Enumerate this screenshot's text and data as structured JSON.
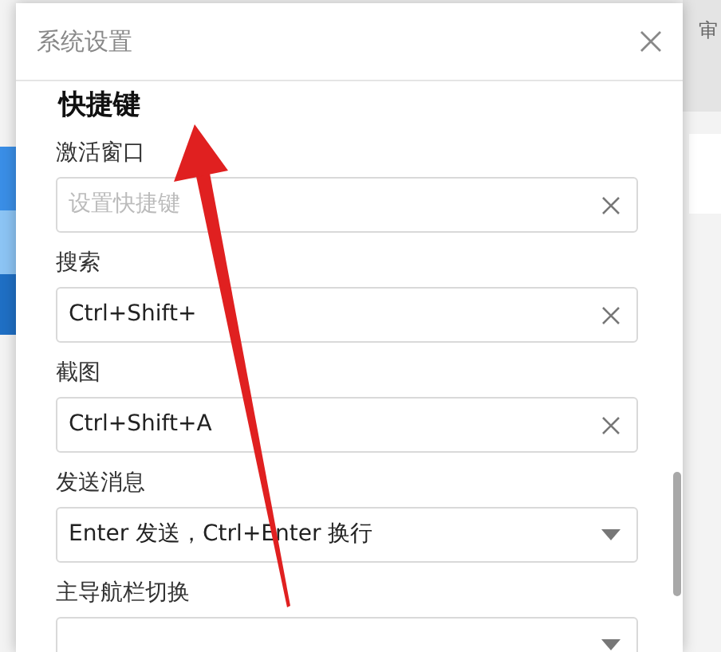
{
  "background": {
    "toolbar_text": "审"
  },
  "dialog": {
    "title": "系统设置",
    "section_title": "快捷键",
    "fields": [
      {
        "kind": "shortcut",
        "label": "激活窗口",
        "placeholder": "设置快捷键"
      },
      {
        "kind": "shortcut",
        "label": "搜索",
        "value": "Ctrl+Shift+"
      },
      {
        "kind": "shortcut",
        "label": "截图",
        "value": "Ctrl+Shift+A"
      },
      {
        "kind": "select",
        "label": "发送消息",
        "value": "Enter 发送，Ctrl+Enter 换行"
      },
      {
        "kind": "select",
        "label": "主导航栏切换"
      }
    ]
  }
}
